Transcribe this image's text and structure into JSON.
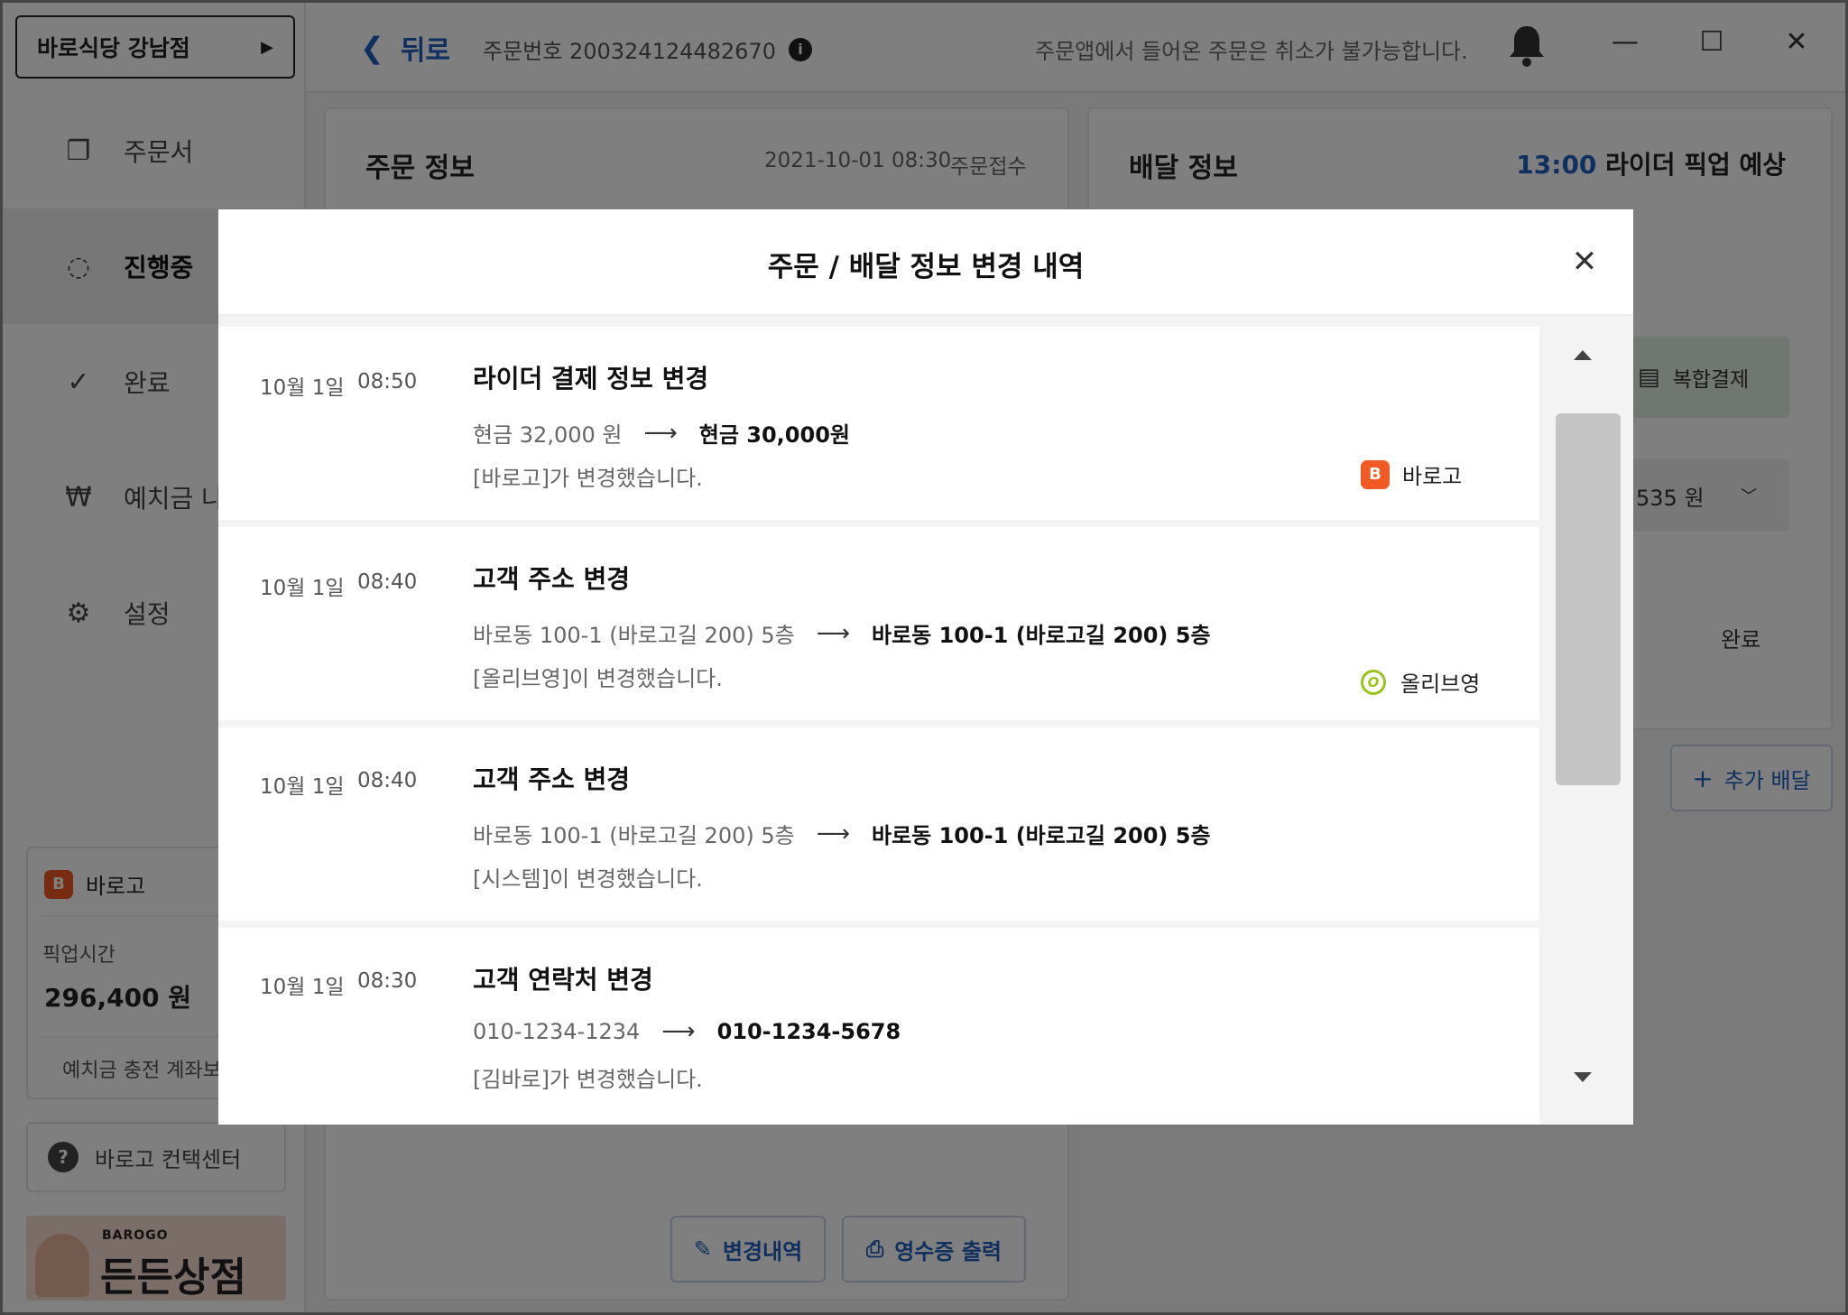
{
  "app": {
    "store_name": "바로식당 강남점",
    "nav": [
      {
        "label": "주문서",
        "icon": "copy-icon"
      },
      {
        "label": "진행중",
        "icon": "progress-icon"
      },
      {
        "label": "완료",
        "icon": "check-icon"
      },
      {
        "label": "예치금 나",
        "icon": "won-icon"
      },
      {
        "label": "설정",
        "icon": "gear-icon"
      }
    ],
    "deposit_card": {
      "brand": "바로고",
      "label": "픽업시간",
      "value": "296,400 원",
      "link": "예치금 충전 계좌보"
    },
    "contact_button": "바로고 컨택센터",
    "banner": {
      "small": "BAROGO",
      "big": "든든상점"
    }
  },
  "topbar": {
    "back_label": "뒤로",
    "order_number": "주문번호 200324124482670",
    "notice": "주문앱에서 들어온 주문은 취소가 불가능합니다."
  },
  "order_panel": {
    "title": "주문 정보",
    "datetime": "2021-10-01 08:30",
    "status": "주문접수",
    "buttons": {
      "history": "변경내역",
      "receipt": "영수증 출력"
    }
  },
  "delivery_panel": {
    "title": "배달 정보",
    "pickup_time": "13:00",
    "pickup_label": "라이더 픽업 예상",
    "payment_chip": "복합결제",
    "amount": "535 원",
    "status": "완료",
    "add_delivery": "추가 배달"
  },
  "modal": {
    "title": "주문 / 배달 정보 변경 내역",
    "history": [
      {
        "date": "10월 1일",
        "time": "08:50",
        "title": "라이더 결제 정보 변경",
        "before": "현금 32,000 원",
        "after": "현금 30,000원",
        "changed_by": "[바로고]가 변경했습니다.",
        "source": "바로고"
      },
      {
        "date": "10월 1일",
        "time": "08:40",
        "title": "고객 주소 변경",
        "before": "바로동 100-1 (바로고길 200) 5층",
        "after": "바로동 100-1 (바로고길 200) 5층",
        "changed_by": "[올리브영]이 변경했습니다.",
        "source": "올리브영"
      },
      {
        "date": "10월 1일",
        "time": "08:40",
        "title": "고객 주소 변경",
        "before": "바로동 100-1 (바로고길 200) 5층",
        "after": "바로동 100-1 (바로고길 200) 5층",
        "changed_by": "[시스템]이 변경했습니다."
      },
      {
        "date": "10월 1일",
        "time": "08:30",
        "title": "고객 연락처 변경",
        "before": "010-1234-1234",
        "after": "010-1234-5678",
        "changed_by": "[김바로]가 변경했습니다."
      }
    ]
  },
  "colors": {
    "accent": "#1f5fbf",
    "barogo": "#f15a24",
    "olive": "#9ac31c",
    "payment_chip": "#dfeee0"
  }
}
